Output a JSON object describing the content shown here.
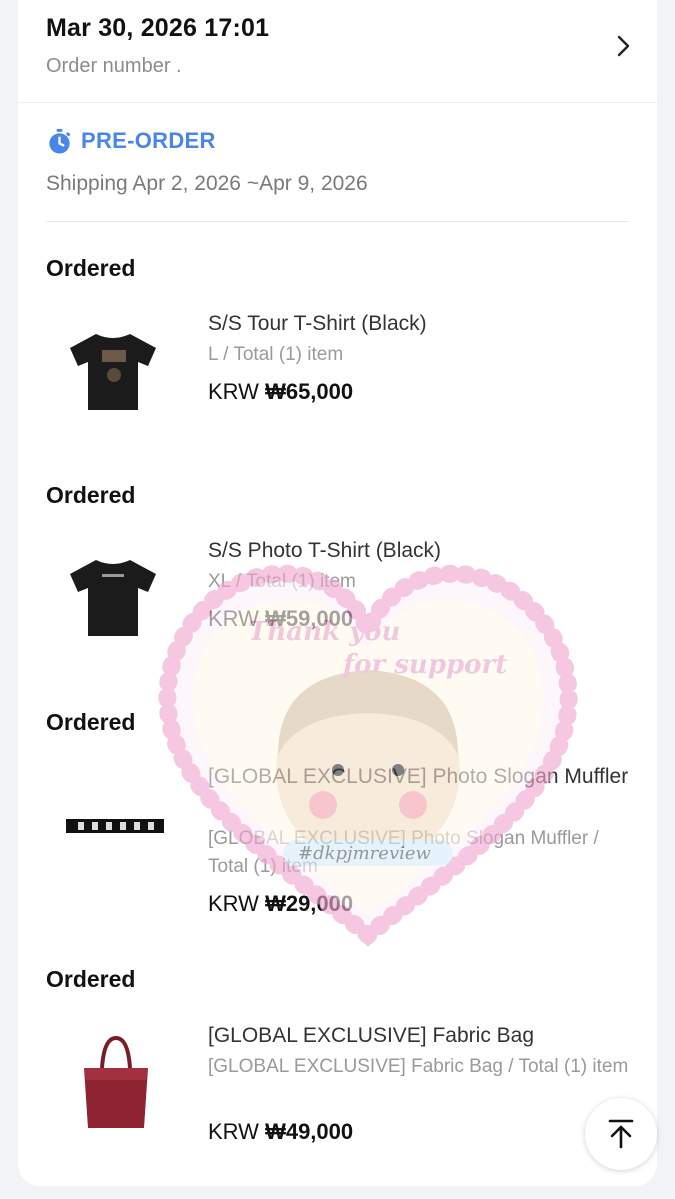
{
  "header": {
    "date": "Mar 30, 2026 17:01",
    "order_number_label": "Order number ."
  },
  "preorder": {
    "label": "PRE-ORDER",
    "shipping": "Shipping Apr 2, 2026 ~Apr 9, 2026"
  },
  "items": [
    {
      "status": "Ordered",
      "name": "S/S Tour T-Shirt (Black)",
      "option": "L / Total (1) item",
      "currency": "KRW",
      "price": "₩65,000",
      "thumb_icon": "tshirt-icon"
    },
    {
      "status": "Ordered",
      "name": "S/S Photo T-Shirt (Black)",
      "option": "XL / Total (1) item",
      "currency": "KRW",
      "price": "₩59,000",
      "thumb_icon": "tshirt-icon"
    },
    {
      "status": "Ordered",
      "name": "[GLOBAL EXCLUSIVE] Photo Slogan Muffler",
      "option": "[GLOBAL EXCLUSIVE] Photo Slogan Muffler / Total (1) item",
      "currency": "KRW",
      "price": "₩29,000",
      "thumb_icon": "muffler-icon"
    },
    {
      "status": "Ordered",
      "name": "[GLOBAL EXCLUSIVE] Fabric Bag",
      "option": "[GLOBAL EXCLUSIVE] Fabric Bag / Total (1) item",
      "currency": "KRW",
      "price": "₩49,000",
      "thumb_icon": "tote-bag-icon"
    }
  ],
  "watermark": {
    "line1": "Thank you",
    "line2": "for support",
    "tag": "#dkpjmreview"
  },
  "icons": {
    "chevron": "chevron-right-icon",
    "preorder": "stopwatch-icon",
    "scroll_top": "arrow-to-top-icon"
  },
  "colors": {
    "accent": "#4a86e8",
    "background": "#f2f3f5",
    "card": "#ffffff"
  }
}
